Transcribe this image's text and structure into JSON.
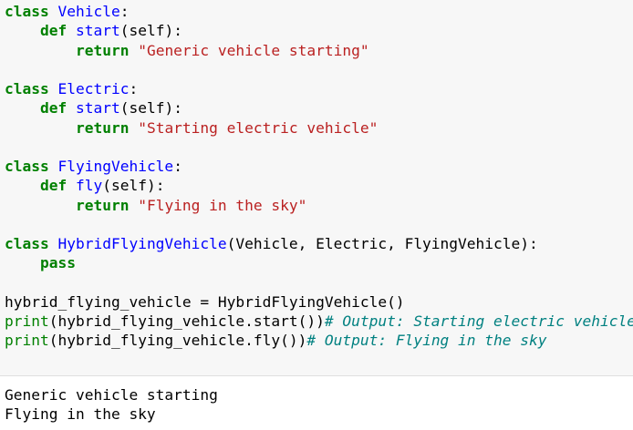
{
  "code": {
    "l1": {
      "kw": "class",
      "name": "Vehicle",
      "colon": ":"
    },
    "l2": {
      "indent": "    ",
      "kw": "def",
      "fname": "start",
      "args": "(self):"
    },
    "l3": {
      "indent": "        ",
      "kw": "return",
      "str": "\"Generic vehicle starting\""
    },
    "l5": {
      "kw": "class",
      "name": "Electric",
      "colon": ":"
    },
    "l6": {
      "indent": "    ",
      "kw": "def",
      "fname": "start",
      "args": "(self):"
    },
    "l7": {
      "indent": "        ",
      "kw": "return",
      "str": "\"Starting electric vehicle\""
    },
    "l9": {
      "kw": "class",
      "name": "FlyingVehicle",
      "colon": ":"
    },
    "l10": {
      "indent": "    ",
      "kw": "def",
      "fname": "fly",
      "args": "(self):"
    },
    "l11": {
      "indent": "        ",
      "kw": "return",
      "str": "\"Flying in the sky\""
    },
    "l13": {
      "kw": "class",
      "name": "HybridFlyingVehicle",
      "bases": "(Vehicle, Electric, FlyingVehicle):"
    },
    "l14": {
      "indent": "    ",
      "kw": "pass"
    },
    "l16": {
      "text": "hybrid_flying_vehicle = HybridFlyingVehicle()"
    },
    "l17": {
      "builtin": "print",
      "expr": "(hybrid_flying_vehicle.start())",
      "comment": "# Output: Starting electric vehicle"
    },
    "l18": {
      "builtin": "print",
      "expr": "(hybrid_flying_vehicle.fly())",
      "comment": "# Output: Flying in the sky"
    }
  },
  "output": {
    "lines": [
      "Generic vehicle starting",
      "Flying in the sky"
    ]
  }
}
